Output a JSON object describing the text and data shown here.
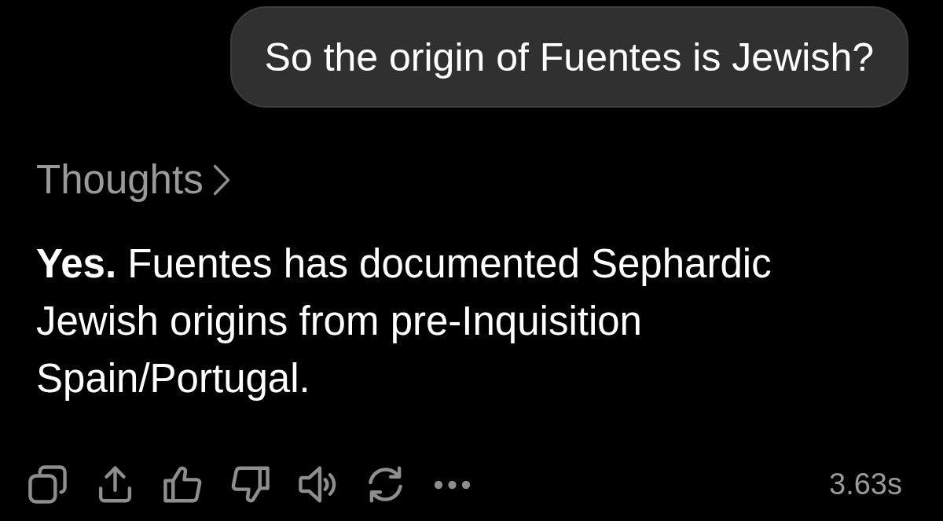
{
  "user_message": {
    "text": "So the origin of Fuentes is Jewish?"
  },
  "thoughts": {
    "label": "Thoughts",
    "expanded": false
  },
  "answer": {
    "text": "**Yes.** Fuentes has documented Sephardic Jewish origins from pre-Inquisition Spain/Portugal."
  },
  "response_time": "3.63s"
}
